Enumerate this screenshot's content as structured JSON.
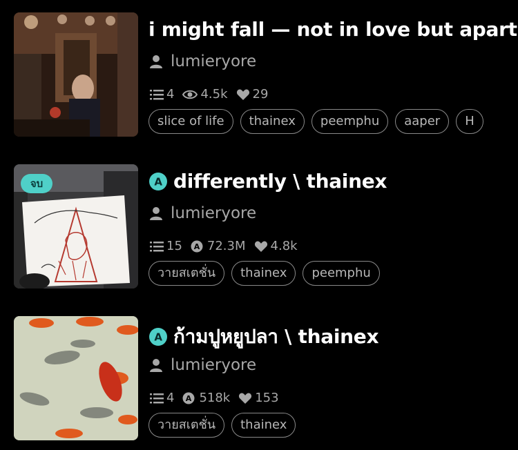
{
  "stories": [
    {
      "title": "i might fall — not in love but apart",
      "author": "lumieryore",
      "parts": "4",
      "views": "4.5k",
      "likes": "29",
      "views_icon": "eye-icon",
      "tags": [
        "slice of life",
        "thainex",
        "peemphu",
        "aaper",
        "H"
      ],
      "cover": "restaurant-cover"
    },
    {
      "badge": "จบ",
      "title": "differently \\ thainex",
      "author": "lumieryore",
      "parts": "15",
      "views": "72.3M",
      "likes": "4.8k",
      "views_icon": "a-coin-icon",
      "tags": [
        "วายสเตชั่น",
        "thainex",
        "peemphu"
      ],
      "cover": "christmas-card-cover"
    },
    {
      "title": "ก้ามปูหยูปลา \\ thainex",
      "author": "lumieryore",
      "parts": "4",
      "views": "518k",
      "likes": "153",
      "views_icon": "a-coin-icon",
      "tags": [
        "วายสเตชั่น",
        "thainex"
      ],
      "cover": "goldfish-cover"
    }
  ],
  "colors": {
    "background": "#000000",
    "accent": "#4fd0c8",
    "muted": "#a8a8a8"
  }
}
